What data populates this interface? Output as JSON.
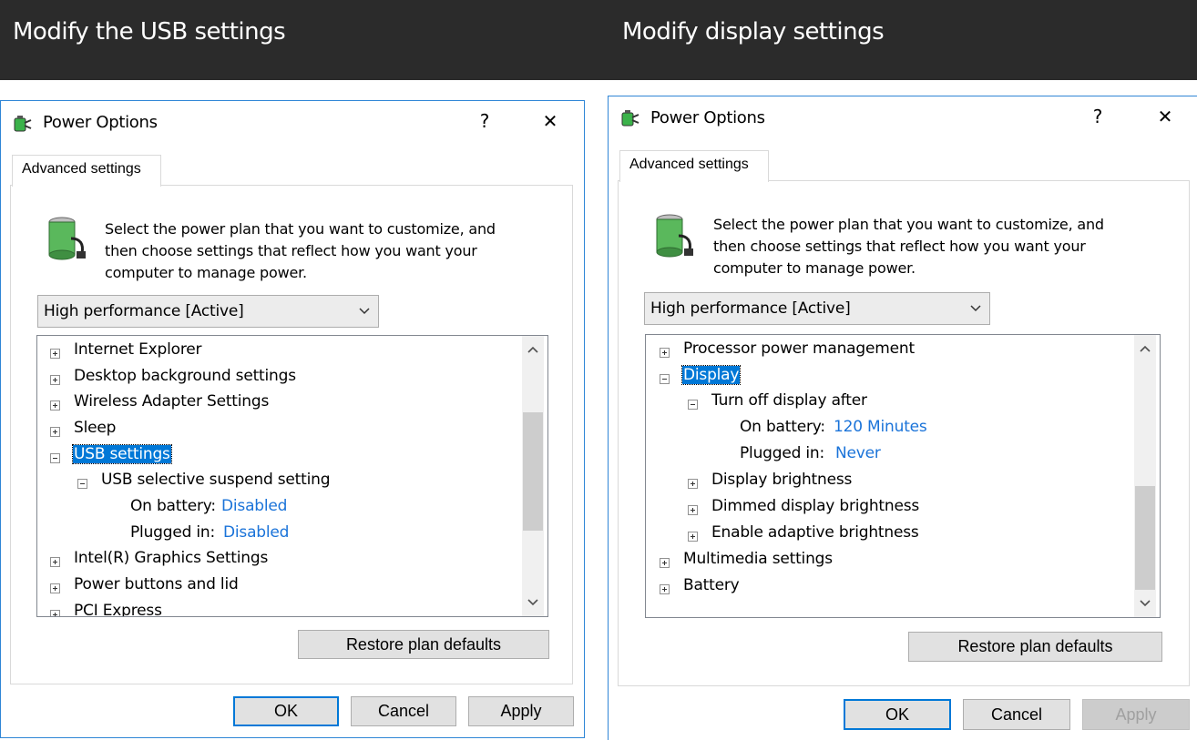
{
  "captions": {
    "left": "Modify the USB settings",
    "right": "Modify display settings"
  },
  "colors": {
    "accent": "#0078d7",
    "link": "#1a73d9",
    "topbar": "#2b2b2b"
  },
  "left_dialog": {
    "title": "Power Options",
    "help": "?",
    "close": "✕",
    "tab": "Advanced settings",
    "description": [
      "Select the power plan that you want to customize, and",
      "then choose settings that reflect how you want your",
      "computer to manage power."
    ],
    "plan": "High performance [Active]",
    "tree": [
      {
        "label": "Internet Explorer"
      },
      {
        "label": "Desktop background settings"
      },
      {
        "label": "Wireless Adapter Settings"
      },
      {
        "label": "Sleep"
      },
      {
        "label": "USB settings"
      },
      {
        "label": "USB selective suspend setting"
      },
      {
        "label": "On battery:",
        "value": "Disabled"
      },
      {
        "label": "Plugged in:",
        "value": "Disabled"
      },
      {
        "label": "Intel(R) Graphics Settings"
      },
      {
        "label": "Power buttons and lid"
      },
      {
        "label": "PCI Express"
      }
    ],
    "restore": "Restore plan defaults",
    "ok": "OK",
    "cancel": "Cancel",
    "apply": "Apply"
  },
  "right_dialog": {
    "title": "Power Options",
    "help": "?",
    "close": "✕",
    "tab": "Advanced settings",
    "description": [
      "Select the power plan that you want to customize, and",
      "then choose settings that reflect how you want your",
      "computer to manage power."
    ],
    "plan": "High performance [Active]",
    "tree": [
      {
        "label": "Processor power management"
      },
      {
        "label": "Display"
      },
      {
        "label": "Turn off display after"
      },
      {
        "label": "On battery:",
        "value": "120 Minutes"
      },
      {
        "label": "Plugged in:",
        "value": "Never"
      },
      {
        "label": "Display brightness"
      },
      {
        "label": "Dimmed display brightness"
      },
      {
        "label": "Enable adaptive brightness"
      },
      {
        "label": "Multimedia settings"
      },
      {
        "label": "Battery"
      }
    ],
    "restore": "Restore plan defaults",
    "ok": "OK",
    "cancel": "Cancel",
    "apply": "Apply"
  }
}
